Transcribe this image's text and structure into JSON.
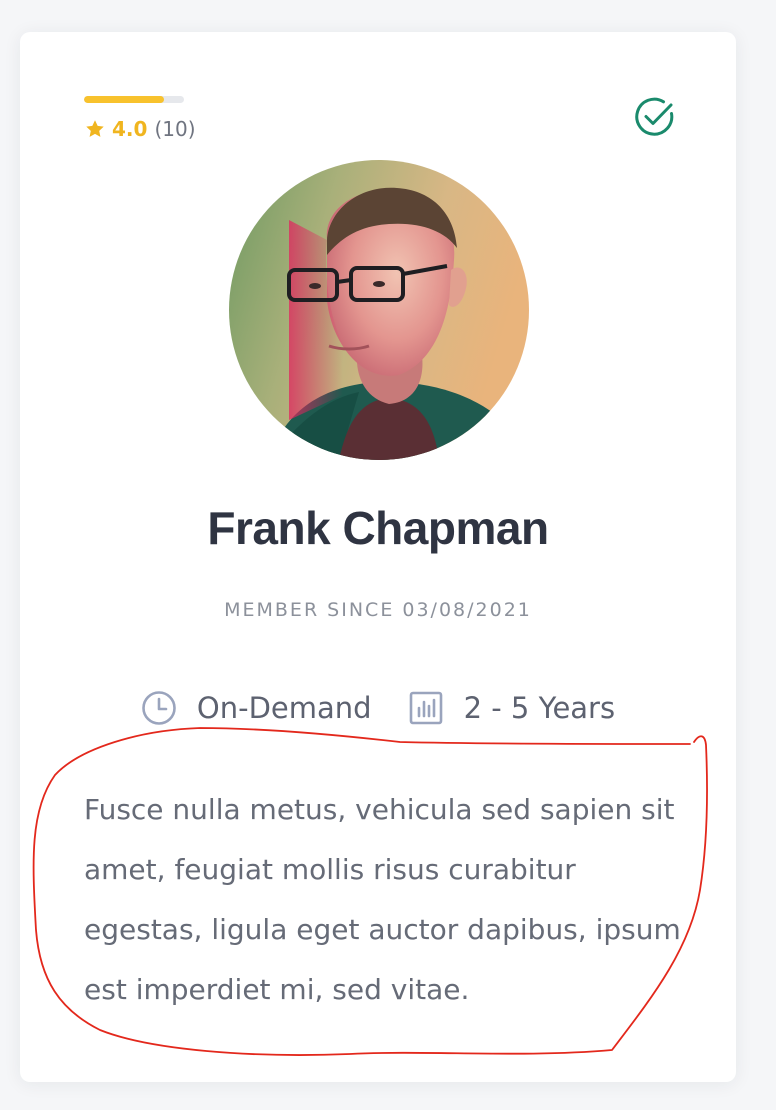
{
  "rating": {
    "score": "4.0",
    "count": "(10)",
    "fill_fraction": 0.8,
    "star_color": "#f0b51f",
    "bar_color": "#f8c22d"
  },
  "verified_icon": "check-circle-icon",
  "profile": {
    "name": "Frank Chapman",
    "member_since": "MEMBER SINCE 03/08/2021",
    "availability": "On-Demand",
    "experience": "2 - 5 Years",
    "description": "Fusce nulla metus, vehicula sed sapien sit amet, feugiat mollis risus curabitur egestas, ligula eget auctor dapibus, ipsum est imperdiet mi, sed vitae."
  },
  "icons": {
    "availability": "clock-icon",
    "experience": "bar-chart-icon"
  },
  "colors": {
    "accent_green": "#1a8a6c",
    "annotation_red": "#e3281c",
    "name_text": "#2f3442"
  }
}
